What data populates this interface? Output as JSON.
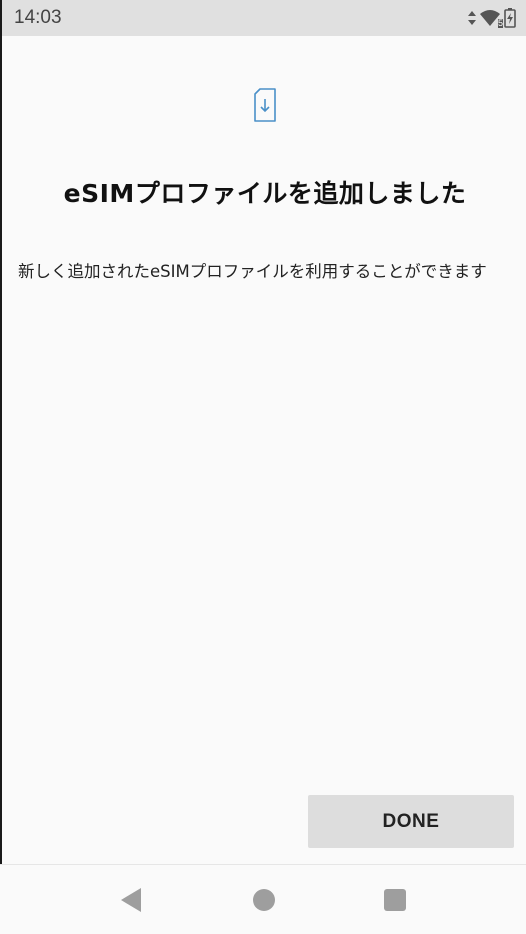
{
  "status_bar": {
    "time": "14:03",
    "icons": [
      "data-arrows-icon",
      "wifi-icon",
      "battery-charging-icon"
    ],
    "wifi_badge": "5"
  },
  "main": {
    "icon": "sim-download-icon",
    "title": "eSIMプロファイルを追加しました",
    "message": "新しく追加されたeSIMプロファイルを利用することができます",
    "done_label": "DONE"
  },
  "nav_bar": {
    "icons": [
      "back-icon",
      "home-icon",
      "recents-icon"
    ]
  },
  "colors": {
    "status_bar_bg": "#e0e0e0",
    "background": "#fafafa",
    "button_bg": "#dddddd",
    "icon_accent": "#4a90c8",
    "nav_icon": "#9e9e9e"
  }
}
